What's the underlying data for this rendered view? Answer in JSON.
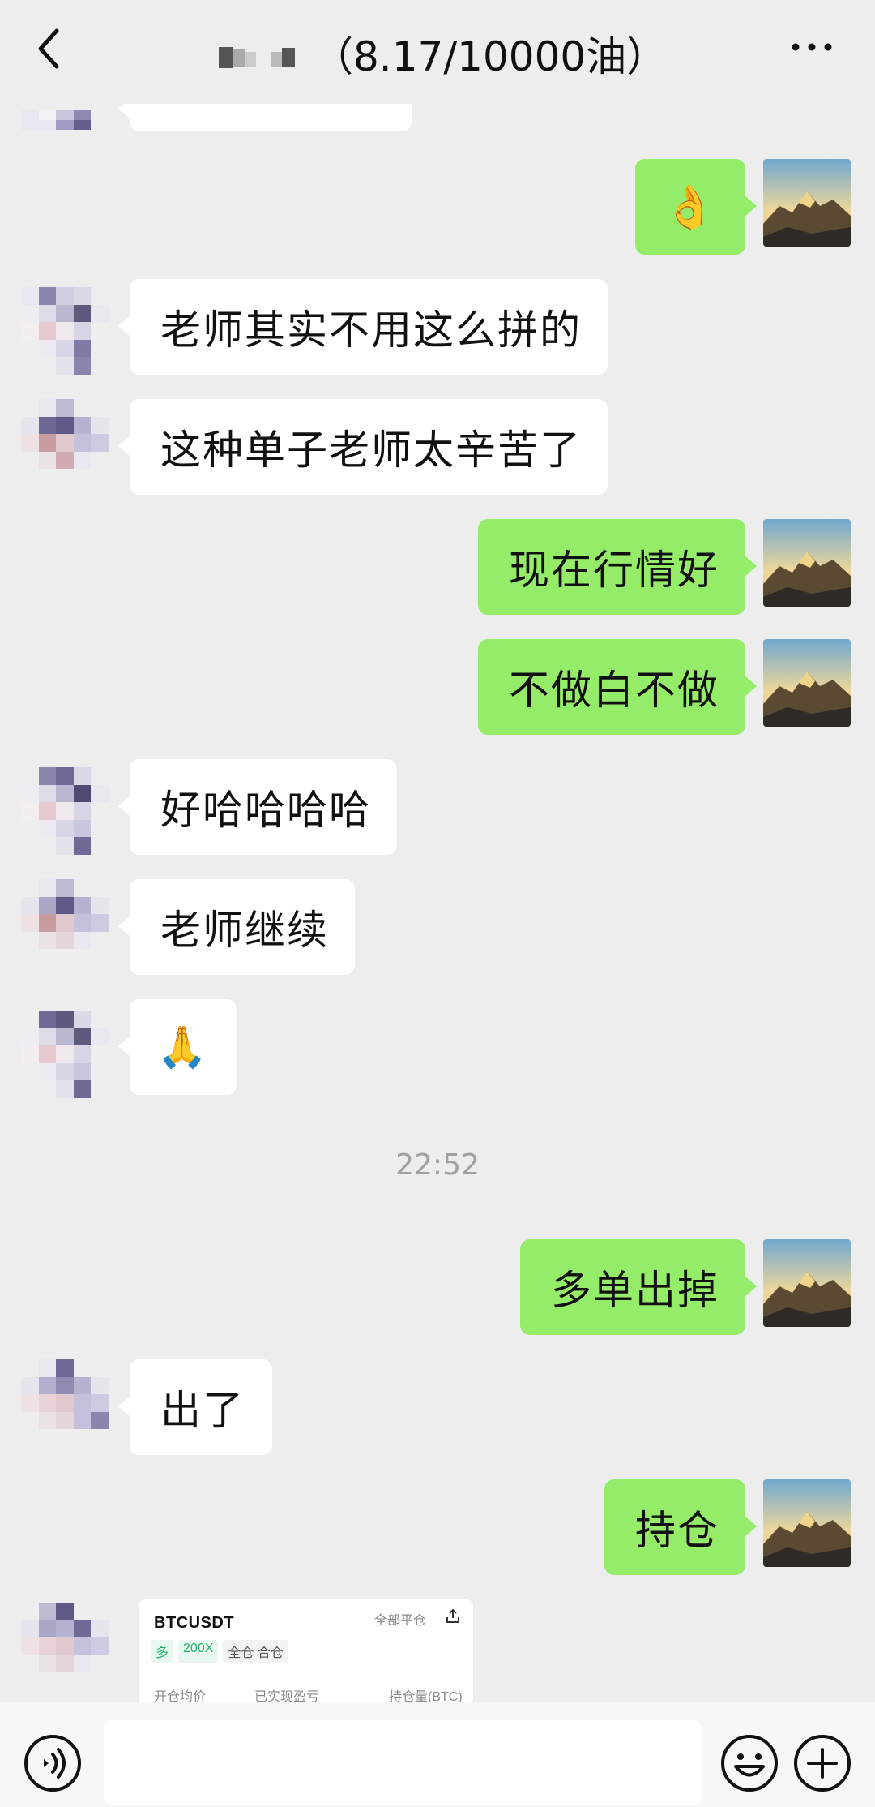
{
  "header": {
    "title": "（8.17/10000油）",
    "back_icon": "chevron-left-icon",
    "more_icon": "more-dots-icon"
  },
  "messages": [
    {
      "side": "left",
      "type": "text",
      "text": "老师其实不用这么拼的"
    },
    {
      "side": "left",
      "type": "text",
      "text": "这种单子老师太辛苦了"
    },
    {
      "side": "right",
      "type": "text",
      "text": "现在行情好"
    },
    {
      "side": "right",
      "type": "text",
      "text": "不做白不做"
    },
    {
      "side": "left",
      "type": "text",
      "text": "好哈哈哈哈"
    },
    {
      "side": "left",
      "type": "text",
      "text": "老师继续"
    },
    {
      "side": "left",
      "type": "emoji",
      "emoji": "🙏"
    },
    {
      "side": "right",
      "type": "text",
      "text": "多单出掉"
    },
    {
      "side": "left",
      "type": "text",
      "text": "出了"
    },
    {
      "side": "right",
      "type": "text",
      "text": "持仓"
    },
    {
      "side": "right",
      "type": "emoji",
      "emoji": "👌"
    }
  ],
  "timestamp": "22:52",
  "trade_card": {
    "symbol": "BTCUSDT",
    "close_all": "全部平仓",
    "direction": "多",
    "leverage": "200X",
    "margin_mode": "全仓 合仓",
    "labels": [
      "开仓均价",
      "已实现盈亏",
      "持仓量(BTC)"
    ]
  },
  "input_bar": {
    "placeholder": "",
    "voice_icon": "voice-icon",
    "emoji_icon": "emoji-face-icon",
    "plus_icon": "plus-icon"
  },
  "colors": {
    "background": "#ededed",
    "bubble_right": "#95ec69",
    "bubble_left": "#ffffff"
  }
}
